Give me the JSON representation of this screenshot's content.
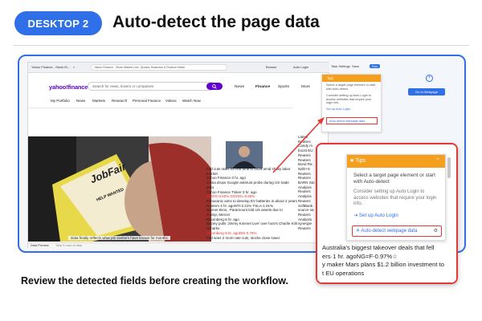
{
  "header": {
    "badge": "DESKTOP 2",
    "title": "Auto-detect the page data"
  },
  "caption": "Review the detected fields before creating the workflow.",
  "browser": {
    "tab_title": "Yahoo Finance - Stock M...",
    "tab_close": "×",
    "address": "Yahoo Finance - Stock Market Live, Quotes, Business & Finance News",
    "toolbar": [
      "Browse",
      "Auto Login",
      "Task Settings",
      "Save",
      "Run"
    ]
  },
  "yahoo": {
    "logo": "yahoo!finance",
    "search_placeholder": "Search for news, tickers or companies",
    "main_nav": [
      "News",
      "Finance",
      "Sports",
      "More"
    ],
    "sub_nav": [
      "My Portfolio",
      "News",
      "Markets",
      "Research",
      "Personal Finance",
      "Videos",
      "Watch Now"
    ],
    "photo_caption": "Data finally reflects what job seekers have known for months",
    "photo_text": {
      "brand": "JobFair",
      "sign": "HELP WANTED"
    },
    "news_lines": [
      {
        "text": "Fed cuts rates for first time in 2025 amid shaky labor",
        "neg": false
      },
      {
        "text": "market",
        "neg": false
      },
      {
        "text": "Yahoo Finance·3 hr. ago",
        "neg": false
      },
      {
        "text": "China drops Google antitrust probe during US trade",
        "neg": false
      },
      {
        "text": "talks",
        "neg": false
      },
      {
        "text": "Yahoo Finance Tinker·3 hr. ago",
        "neg": false
      },
      {
        "text": "GOOG-0.62%  GOOGL-0.65%",
        "neg": true
      },
      {
        "text": "Panasonic aims to develop EV batteries in about 2 years",
        "neg": false
      },
      {
        "text": "Reuters·4 hr. agoNTI-2.21%  TSLA-1.01%",
        "neg": false
      },
      {
        "text": "Warner Bros., Paramount told US assets due to",
        "neg": false
      },
      {
        "text": "Trump, Mercer",
        "neg": false
      },
      {
        "text": "Bloomberg·6 hr. ago",
        "neg": false
      },
      {
        "text": "Disney pulls 'Jimmy Kimmel Live' over host's Charlie Kirk",
        "neg": false
      },
      {
        "text": "remarks",
        "neg": false
      },
      {
        "text": "Bloomberg·9 hr. agoDIS-0.76%",
        "neg": true
      },
      {
        "text": "Fed sees 2 more rate cuts, stocks close lower",
        "neg": false
      }
    ],
    "right_lines": [
      "Latest",
      "Reuters",
      "Candy m",
      "boost EU",
      "Reuters",
      "Reuters",
      "Bond Ra",
      "NZD+S",
      "Reuters",
      "Reuters",
      "BARN Sto",
      "Analysis",
      "Reuters",
      "Analysis",
      "Reuters",
      "SoftBank",
      "source sa",
      "Reuters",
      "Analysts",
      "synergie",
      "Reuters"
    ],
    "lead_line": "takeover deals that fell"
  },
  "bottom_bar": {
    "label": "Data Preview",
    "count": "Total 0 rows of data"
  },
  "side_panel": {
    "go_button": "Go to Webpage",
    "plus": "+"
  },
  "tips": {
    "title": "Tips",
    "text1": "Select a target page element or start with Auto-detect",
    "text2": "Consider setting up Auto Login to access websites that require your login info.",
    "auto_login": "Set up Auto Login",
    "auto_detect": "Auto-detect webpage data"
  },
  "zoom_news": [
    {
      "text": "Australia's biggest takeover deals that fell",
      "neg": false
    },
    {
      "text": "ers·1 hr. agoNG=F-0.97%☆",
      "neg": false
    },
    {
      "text": "y maker Mars plans $1.2 billion investment to",
      "neg": false
    },
    {
      "text": "t EU operations",
      "neg": false
    }
  ],
  "colors": {
    "accent": "#2f6fe8",
    "highlight": "#e53935",
    "tips_header": "#f4a01e",
    "yahoo": "#5f01d1"
  }
}
